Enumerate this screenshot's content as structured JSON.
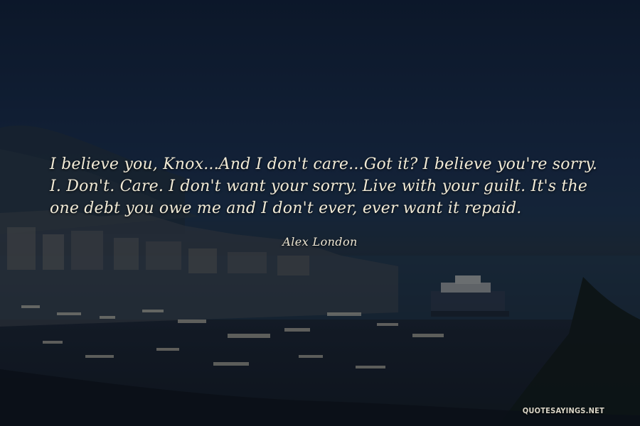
{
  "quote": {
    "text": "I believe you, Knox...And I don't care...Got it? I believe you're sorry. I. Don't. Care. I don't want your sorry. Live with your guilt. It's the one debt you owe me and I don't ever, ever want it repaid.",
    "author": "Alex London"
  },
  "watermark": "QUOTESAYINGS.NET",
  "colors": {
    "sky": "#12223a",
    "text": "#f1ead6",
    "harbor": "#1f2d3a"
  }
}
